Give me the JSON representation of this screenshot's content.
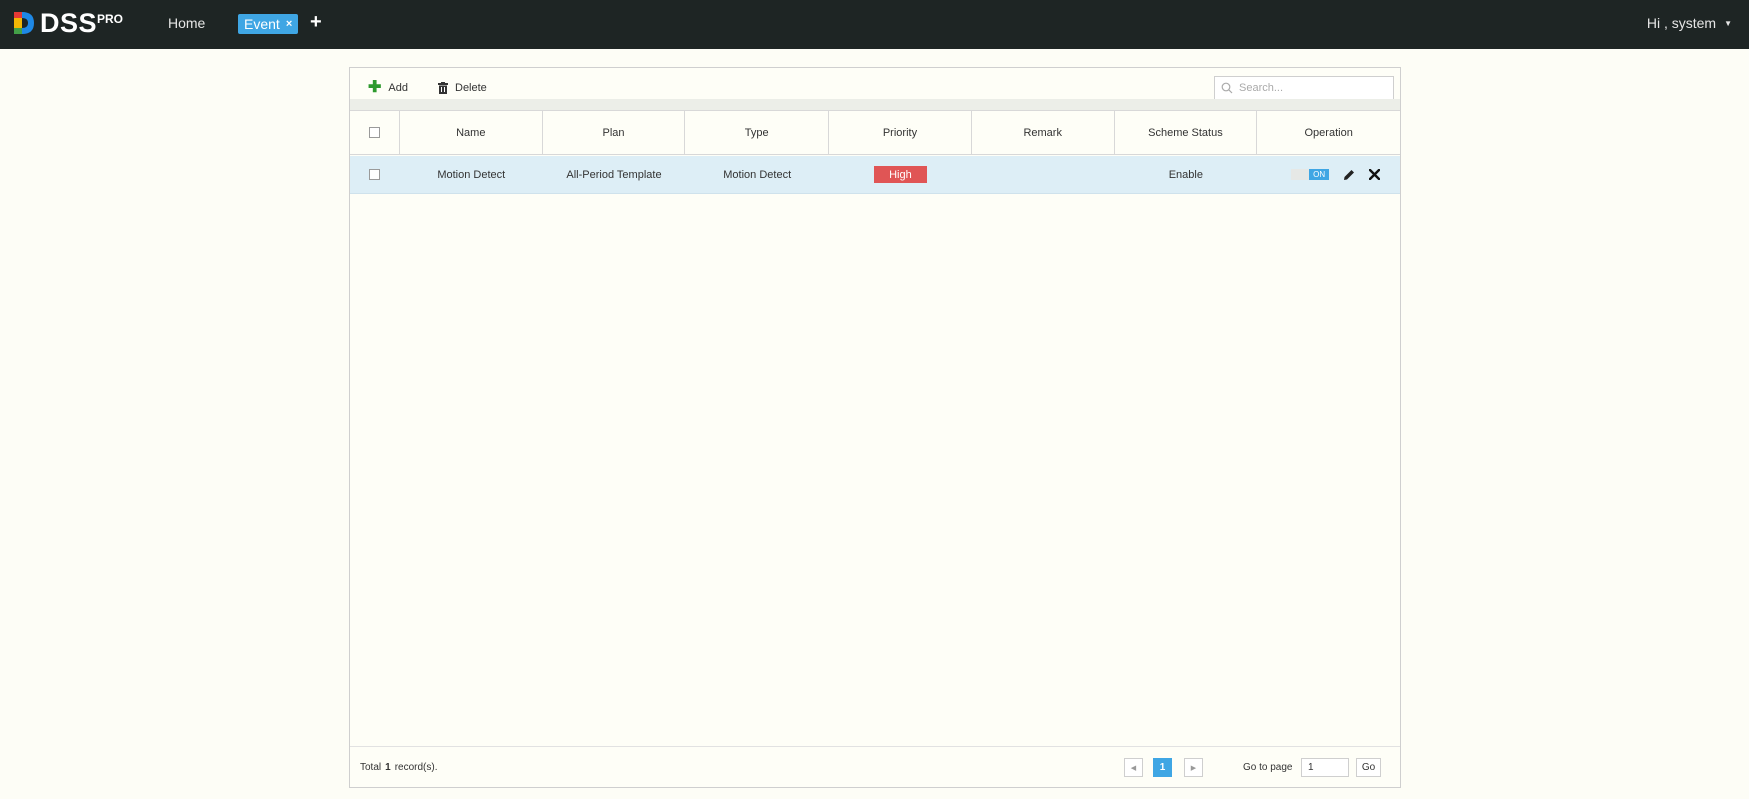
{
  "header": {
    "brand": "DSS",
    "brand_sup": "PRO",
    "home_label": "Home",
    "active_tab_label": "Event",
    "tab_close": "×",
    "add_tab": "+",
    "user_label": "Hi , system",
    "user_caret": "▼"
  },
  "toolbar": {
    "add_label": "Add",
    "delete_label": "Delete",
    "search_placeholder": "Search..."
  },
  "table": {
    "columns": [
      "Name",
      "Plan",
      "Type",
      "Priority",
      "Remark",
      "Scheme Status",
      "Operation"
    ],
    "rows": [
      {
        "name": "Motion Detect",
        "plan": "All-Period Template",
        "type": "Motion Detect",
        "priority": "High",
        "remark": "",
        "scheme_status": "Enable",
        "toggle_label": "ON"
      }
    ]
  },
  "footer": {
    "total_prefix": "Total",
    "total_count": "1",
    "total_suffix": "record(s).",
    "current_page": "1",
    "goto_label": "Go to page",
    "goto_value": "1",
    "go_button": "Go"
  },
  "colors": {
    "topbar": "#1e2524",
    "accent": "#3fa6e4",
    "priority_high": "#e05555",
    "selected_row": "#ddeef6"
  }
}
